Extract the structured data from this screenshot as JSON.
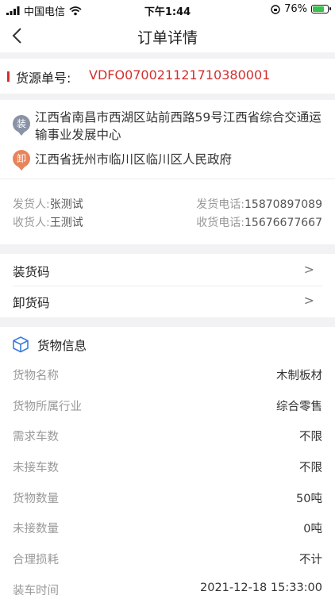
{
  "status_bar": {
    "carrier": "中国电信",
    "time": "下午1:44",
    "battery_text": "76%",
    "battery_level": 0.76,
    "battery_color": "#3ac34a"
  },
  "nav": {
    "title": "订单详情"
  },
  "order": {
    "label": "货源单号:",
    "value": "VDFO070021121710380001",
    "accent": "#d32f2f"
  },
  "address": {
    "load_badge": "装",
    "load_text": "江西省南昌市西湖区站前西路59号江西省综合交通运输事业发展中心",
    "unload_badge": "卸",
    "unload_text": "江西省抚州市临川区临川区人民政府"
  },
  "contacts": {
    "shipper_label": "发货人:",
    "shipper_name": "张测试",
    "shipper_phone_label": "发货电话:",
    "shipper_phone": "15870897089",
    "receiver_label": "收货人:",
    "receiver_name": "王测试",
    "receiver_phone_label": "收货电话:",
    "receiver_phone": "15676677667"
  },
  "codes": [
    {
      "label": "装货码",
      "arrow": ">"
    },
    {
      "label": "卸货码",
      "arrow": ">"
    }
  ],
  "goods": {
    "title": "货物信息",
    "rows": [
      {
        "label": "货物名称",
        "value": "木制板材"
      },
      {
        "label": "货物所属行业",
        "value": "综合零售"
      },
      {
        "label": "需求车数",
        "value": "不限"
      },
      {
        "label": "未接车数",
        "value": "不限"
      },
      {
        "label": "货物数量",
        "value": "50吨"
      },
      {
        "label": "未接数量",
        "value": "0吨"
      },
      {
        "label": "合理损耗",
        "value": "不计"
      },
      {
        "label": "装车时间",
        "value": "2021-12-18 15:33:00"
      }
    ]
  }
}
